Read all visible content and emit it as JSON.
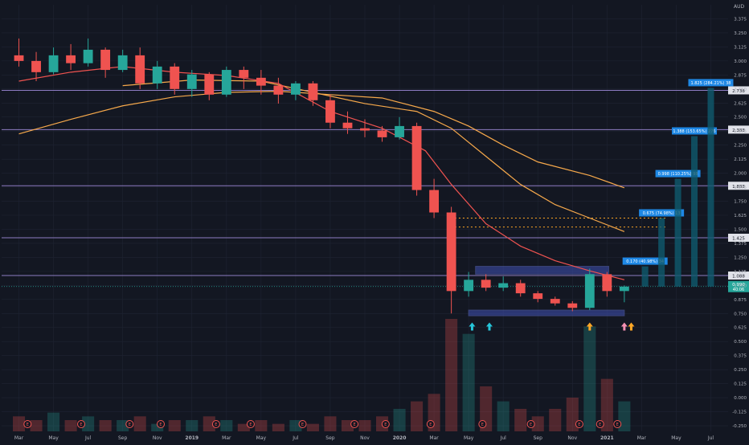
{
  "currency": "AUD",
  "colors": {
    "background": "#131722",
    "grid": "#1f2433",
    "axis_text": "#b2b5be",
    "up": "#26a69a",
    "down": "#ef5350",
    "ma_short": "#ef5350",
    "ma_long": "#f7a94b",
    "level_line": "#8e7cc3",
    "zone_fill": "#3f51b5",
    "target_box": "#1e88e5",
    "target_bar": "#0f5a6e",
    "price_tag": "#26a69a",
    "arrow_cyan": "#26c6da",
    "arrow_orange": "#ffa726",
    "arrow_pink": "#f48fb1"
  },
  "chart_data": {
    "type": "candlestick",
    "title": "",
    "y_axis": {
      "min": -0.3,
      "max": 3.5,
      "ticks": [
        "3.375",
        "3.250",
        "3.125",
        "3.000",
        "2.875",
        "2.750",
        "2.625",
        "2.500",
        "2.375",
        "2.250",
        "2.125",
        "2.000",
        "1.875",
        "1.750",
        "1.625",
        "1.500",
        "1.375",
        "1.250",
        "1.125",
        "1.000",
        "0.875",
        "0.750",
        "0.625",
        "0.500",
        "0.375",
        "0.250",
        "0.125",
        "0.000",
        "-0.125",
        "-0.250"
      ]
    },
    "x_axis": {
      "labels": [
        "Mar",
        "May",
        "Jul",
        "Sep",
        "Nov",
        "2019",
        "Mar",
        "May",
        "Jul",
        "Sep",
        "Nov",
        "2020",
        "Mar",
        "May",
        "Jul",
        "Sep",
        "Nov",
        "2021",
        "Mar",
        "May",
        "Jul"
      ]
    },
    "horizontal_levels": [
      {
        "value": 2.738,
        "label": "2.738"
      },
      {
        "value": 2.388,
        "label": "2.388"
      },
      {
        "value": 1.888,
        "label": "1.888"
      },
      {
        "value": 1.425,
        "label": "1.425"
      },
      {
        "value": 1.088,
        "label": "1.088"
      }
    ],
    "current_price": {
      "value": 0.99,
      "label": "0.990",
      "countdown": "40:06"
    },
    "dotted_levels": [
      1.6,
      1.52
    ],
    "zones": [
      {
        "from_month": 26.4,
        "to_month": 34.1,
        "low": 1.1,
        "high": 1.17
      },
      {
        "from_month": 26.0,
        "to_month": 35.0,
        "low": 0.73,
        "high": 0.78
      }
    ],
    "targets": [
      {
        "label": "0.170 (40.98%) 34",
        "value": 1.17
      },
      {
        "label": "0.675 (74.98%) 13",
        "value": 1.6
      },
      {
        "label": "0.998 (110.25%) 98",
        "value": 1.95
      },
      {
        "label": "1.388 (153.65%) 276",
        "value": 2.33
      },
      {
        "label": "1.825 (284.21%) 38",
        "value": 2.76
      }
    ],
    "monthly_candles": [
      {
        "m": 0,
        "o": 3.05,
        "h": 3.2,
        "l": 2.95,
        "c": 3.0
      },
      {
        "m": 1,
        "o": 3.0,
        "h": 3.08,
        "l": 2.82,
        "c": 2.9
      },
      {
        "m": 2,
        "o": 2.9,
        "h": 3.12,
        "l": 2.88,
        "c": 3.05
      },
      {
        "m": 3,
        "o": 3.05,
        "h": 3.15,
        "l": 2.92,
        "c": 2.98
      },
      {
        "m": 4,
        "o": 2.98,
        "h": 3.2,
        "l": 2.95,
        "c": 3.1
      },
      {
        "m": 5,
        "o": 3.1,
        "h": 3.12,
        "l": 2.85,
        "c": 2.92
      },
      {
        "m": 6,
        "o": 2.92,
        "h": 3.1,
        "l": 2.9,
        "c": 3.05
      },
      {
        "m": 7,
        "o": 3.05,
        "h": 3.12,
        "l": 2.75,
        "c": 2.8
      },
      {
        "m": 8,
        "o": 2.8,
        "h": 3.0,
        "l": 2.75,
        "c": 2.95
      },
      {
        "m": 9,
        "o": 2.95,
        "h": 2.98,
        "l": 2.7,
        "c": 2.75
      },
      {
        "m": 10,
        "o": 2.75,
        "h": 2.92,
        "l": 2.68,
        "c": 2.88
      },
      {
        "m": 11,
        "o": 2.88,
        "h": 2.9,
        "l": 2.65,
        "c": 2.7
      },
      {
        "m": 12,
        "o": 2.7,
        "h": 2.95,
        "l": 2.68,
        "c": 2.92
      },
      {
        "m": 13,
        "o": 2.92,
        "h": 2.95,
        "l": 2.75,
        "c": 2.85
      },
      {
        "m": 14,
        "o": 2.85,
        "h": 2.92,
        "l": 2.7,
        "c": 2.78
      },
      {
        "m": 15,
        "o": 2.78,
        "h": 2.85,
        "l": 2.62,
        "c": 2.7
      },
      {
        "m": 16,
        "o": 2.7,
        "h": 2.82,
        "l": 2.65,
        "c": 2.8
      },
      {
        "m": 17,
        "o": 2.8,
        "h": 2.82,
        "l": 2.6,
        "c": 2.65
      },
      {
        "m": 18,
        "o": 2.65,
        "h": 2.7,
        "l": 2.4,
        "c": 2.45
      },
      {
        "m": 19,
        "o": 2.45,
        "h": 2.55,
        "l": 2.35,
        "c": 2.4
      },
      {
        "m": 20,
        "o": 2.4,
        "h": 2.48,
        "l": 2.32,
        "c": 2.38
      },
      {
        "m": 21,
        "o": 2.38,
        "h": 2.42,
        "l": 2.28,
        "c": 2.32
      },
      {
        "m": 22,
        "o": 2.32,
        "h": 2.5,
        "l": 2.3,
        "c": 2.42
      },
      {
        "m": 23,
        "o": 2.42,
        "h": 2.45,
        "l": 1.8,
        "c": 1.85
      },
      {
        "m": 24,
        "o": 1.85,
        "h": 1.95,
        "l": 1.6,
        "c": 1.65
      },
      {
        "m": 25,
        "o": 1.65,
        "h": 1.7,
        "l": 0.75,
        "c": 0.95
      },
      {
        "m": 26,
        "o": 0.95,
        "h": 1.12,
        "l": 0.9,
        "c": 1.05
      },
      {
        "m": 27,
        "o": 1.05,
        "h": 1.1,
        "l": 0.95,
        "c": 0.98
      },
      {
        "m": 28,
        "o": 0.98,
        "h": 1.08,
        "l": 0.95,
        "c": 1.02
      },
      {
        "m": 29,
        "o": 1.02,
        "h": 1.05,
        "l": 0.9,
        "c": 0.93
      },
      {
        "m": 30,
        "o": 0.93,
        "h": 0.95,
        "l": 0.85,
        "c": 0.88
      },
      {
        "m": 31,
        "o": 0.88,
        "h": 0.9,
        "l": 0.82,
        "c": 0.84
      },
      {
        "m": 32,
        "o": 0.84,
        "h": 0.86,
        "l": 0.77,
        "c": 0.8
      },
      {
        "m": 33,
        "o": 0.8,
        "h": 1.15,
        "l": 0.78,
        "c": 1.1
      },
      {
        "m": 34,
        "o": 1.1,
        "h": 1.12,
        "l": 0.9,
        "c": 0.95
      },
      {
        "m": 35,
        "o": 0.95,
        "h": 1.0,
        "l": 0.85,
        "c": 0.99
      }
    ],
    "ma_short": [
      {
        "m": 0,
        "v": 2.82
      },
      {
        "m": 3,
        "v": 2.9
      },
      {
        "m": 6,
        "v": 2.95
      },
      {
        "m": 9,
        "v": 2.9
      },
      {
        "m": 12,
        "v": 2.87
      },
      {
        "m": 15,
        "v": 2.8
      },
      {
        "m": 18,
        "v": 2.55
      },
      {
        "m": 21,
        "v": 2.4
      },
      {
        "m": 23.5,
        "v": 2.2
      },
      {
        "m": 25,
        "v": 1.9
      },
      {
        "m": 27,
        "v": 1.55
      },
      {
        "m": 29,
        "v": 1.35
      },
      {
        "m": 31,
        "v": 1.22
      },
      {
        "m": 33,
        "v": 1.13
      },
      {
        "m": 35,
        "v": 1.05
      }
    ],
    "ma_mid": [
      {
        "m": 6,
        "v": 2.78
      },
      {
        "m": 10,
        "v": 2.83
      },
      {
        "m": 14,
        "v": 2.82
      },
      {
        "m": 17,
        "v": 2.72
      },
      {
        "m": 20,
        "v": 2.62
      },
      {
        "m": 23,
        "v": 2.55
      },
      {
        "m": 25,
        "v": 2.4
      },
      {
        "m": 27,
        "v": 2.15
      },
      {
        "m": 29,
        "v": 1.9
      },
      {
        "m": 31,
        "v": 1.72
      },
      {
        "m": 33,
        "v": 1.6
      },
      {
        "m": 35,
        "v": 1.48
      }
    ],
    "ma_long": [
      {
        "m": 0,
        "v": 2.35
      },
      {
        "m": 3,
        "v": 2.48
      },
      {
        "m": 6,
        "v": 2.6
      },
      {
        "m": 9,
        "v": 2.68
      },
      {
        "m": 12,
        "v": 2.72
      },
      {
        "m": 15,
        "v": 2.73
      },
      {
        "m": 18,
        "v": 2.7
      },
      {
        "m": 21,
        "v": 2.67
      },
      {
        "m": 24,
        "v": 2.55
      },
      {
        "m": 26,
        "v": 2.42
      },
      {
        "m": 28,
        "v": 2.25
      },
      {
        "m": 30,
        "v": 2.1
      },
      {
        "m": 33,
        "v": 1.98
      },
      {
        "m": 35,
        "v": 1.87
      }
    ],
    "volume": [
      {
        "m": 0,
        "v": 4
      },
      {
        "m": 1,
        "v": 3
      },
      {
        "m": 2,
        "v": 5
      },
      {
        "m": 3,
        "v": 3
      },
      {
        "m": 4,
        "v": 4
      },
      {
        "m": 5,
        "v": 3
      },
      {
        "m": 6,
        "v": 3
      },
      {
        "m": 7,
        "v": 4
      },
      {
        "m": 8,
        "v": 2
      },
      {
        "m": 9,
        "v": 3
      },
      {
        "m": 10,
        "v": 3
      },
      {
        "m": 11,
        "v": 4
      },
      {
        "m": 12,
        "v": 3
      },
      {
        "m": 13,
        "v": 2
      },
      {
        "m": 14,
        "v": 3
      },
      {
        "m": 15,
        "v": 2
      },
      {
        "m": 16,
        "v": 3
      },
      {
        "m": 17,
        "v": 2
      },
      {
        "m": 18,
        "v": 4
      },
      {
        "m": 19,
        "v": 3
      },
      {
        "m": 20,
        "v": 3
      },
      {
        "m": 21,
        "v": 4
      },
      {
        "m": 22,
        "v": 6
      },
      {
        "m": 23,
        "v": 8
      },
      {
        "m": 24,
        "v": 10
      },
      {
        "m": 25,
        "v": 30
      },
      {
        "m": 26,
        "v": 26
      },
      {
        "m": 27,
        "v": 12
      },
      {
        "m": 28,
        "v": 8
      },
      {
        "m": 29,
        "v": 6
      },
      {
        "m": 30,
        "v": 4
      },
      {
        "m": 31,
        "v": 6
      },
      {
        "m": 32,
        "v": 9
      },
      {
        "m": 33,
        "v": 28
      },
      {
        "m": 34,
        "v": 14
      },
      {
        "m": 35,
        "v": 8
      }
    ],
    "earnings_markers": [
      0.5,
      3.6,
      6.4,
      8.2,
      11.4,
      13.4,
      16.4,
      19.4,
      21.2,
      23.8,
      26.8,
      29.6,
      32.4,
      33.6,
      34.6
    ],
    "arrows": [
      {
        "m": 26.2,
        "color": "arrow_cyan"
      },
      {
        "m": 27.2,
        "color": "arrow_cyan"
      },
      {
        "m": 33.0,
        "color": "arrow_orange"
      },
      {
        "m": 35.0,
        "color": "arrow_pink"
      },
      {
        "m": 35.4,
        "color": "arrow_orange"
      }
    ]
  }
}
